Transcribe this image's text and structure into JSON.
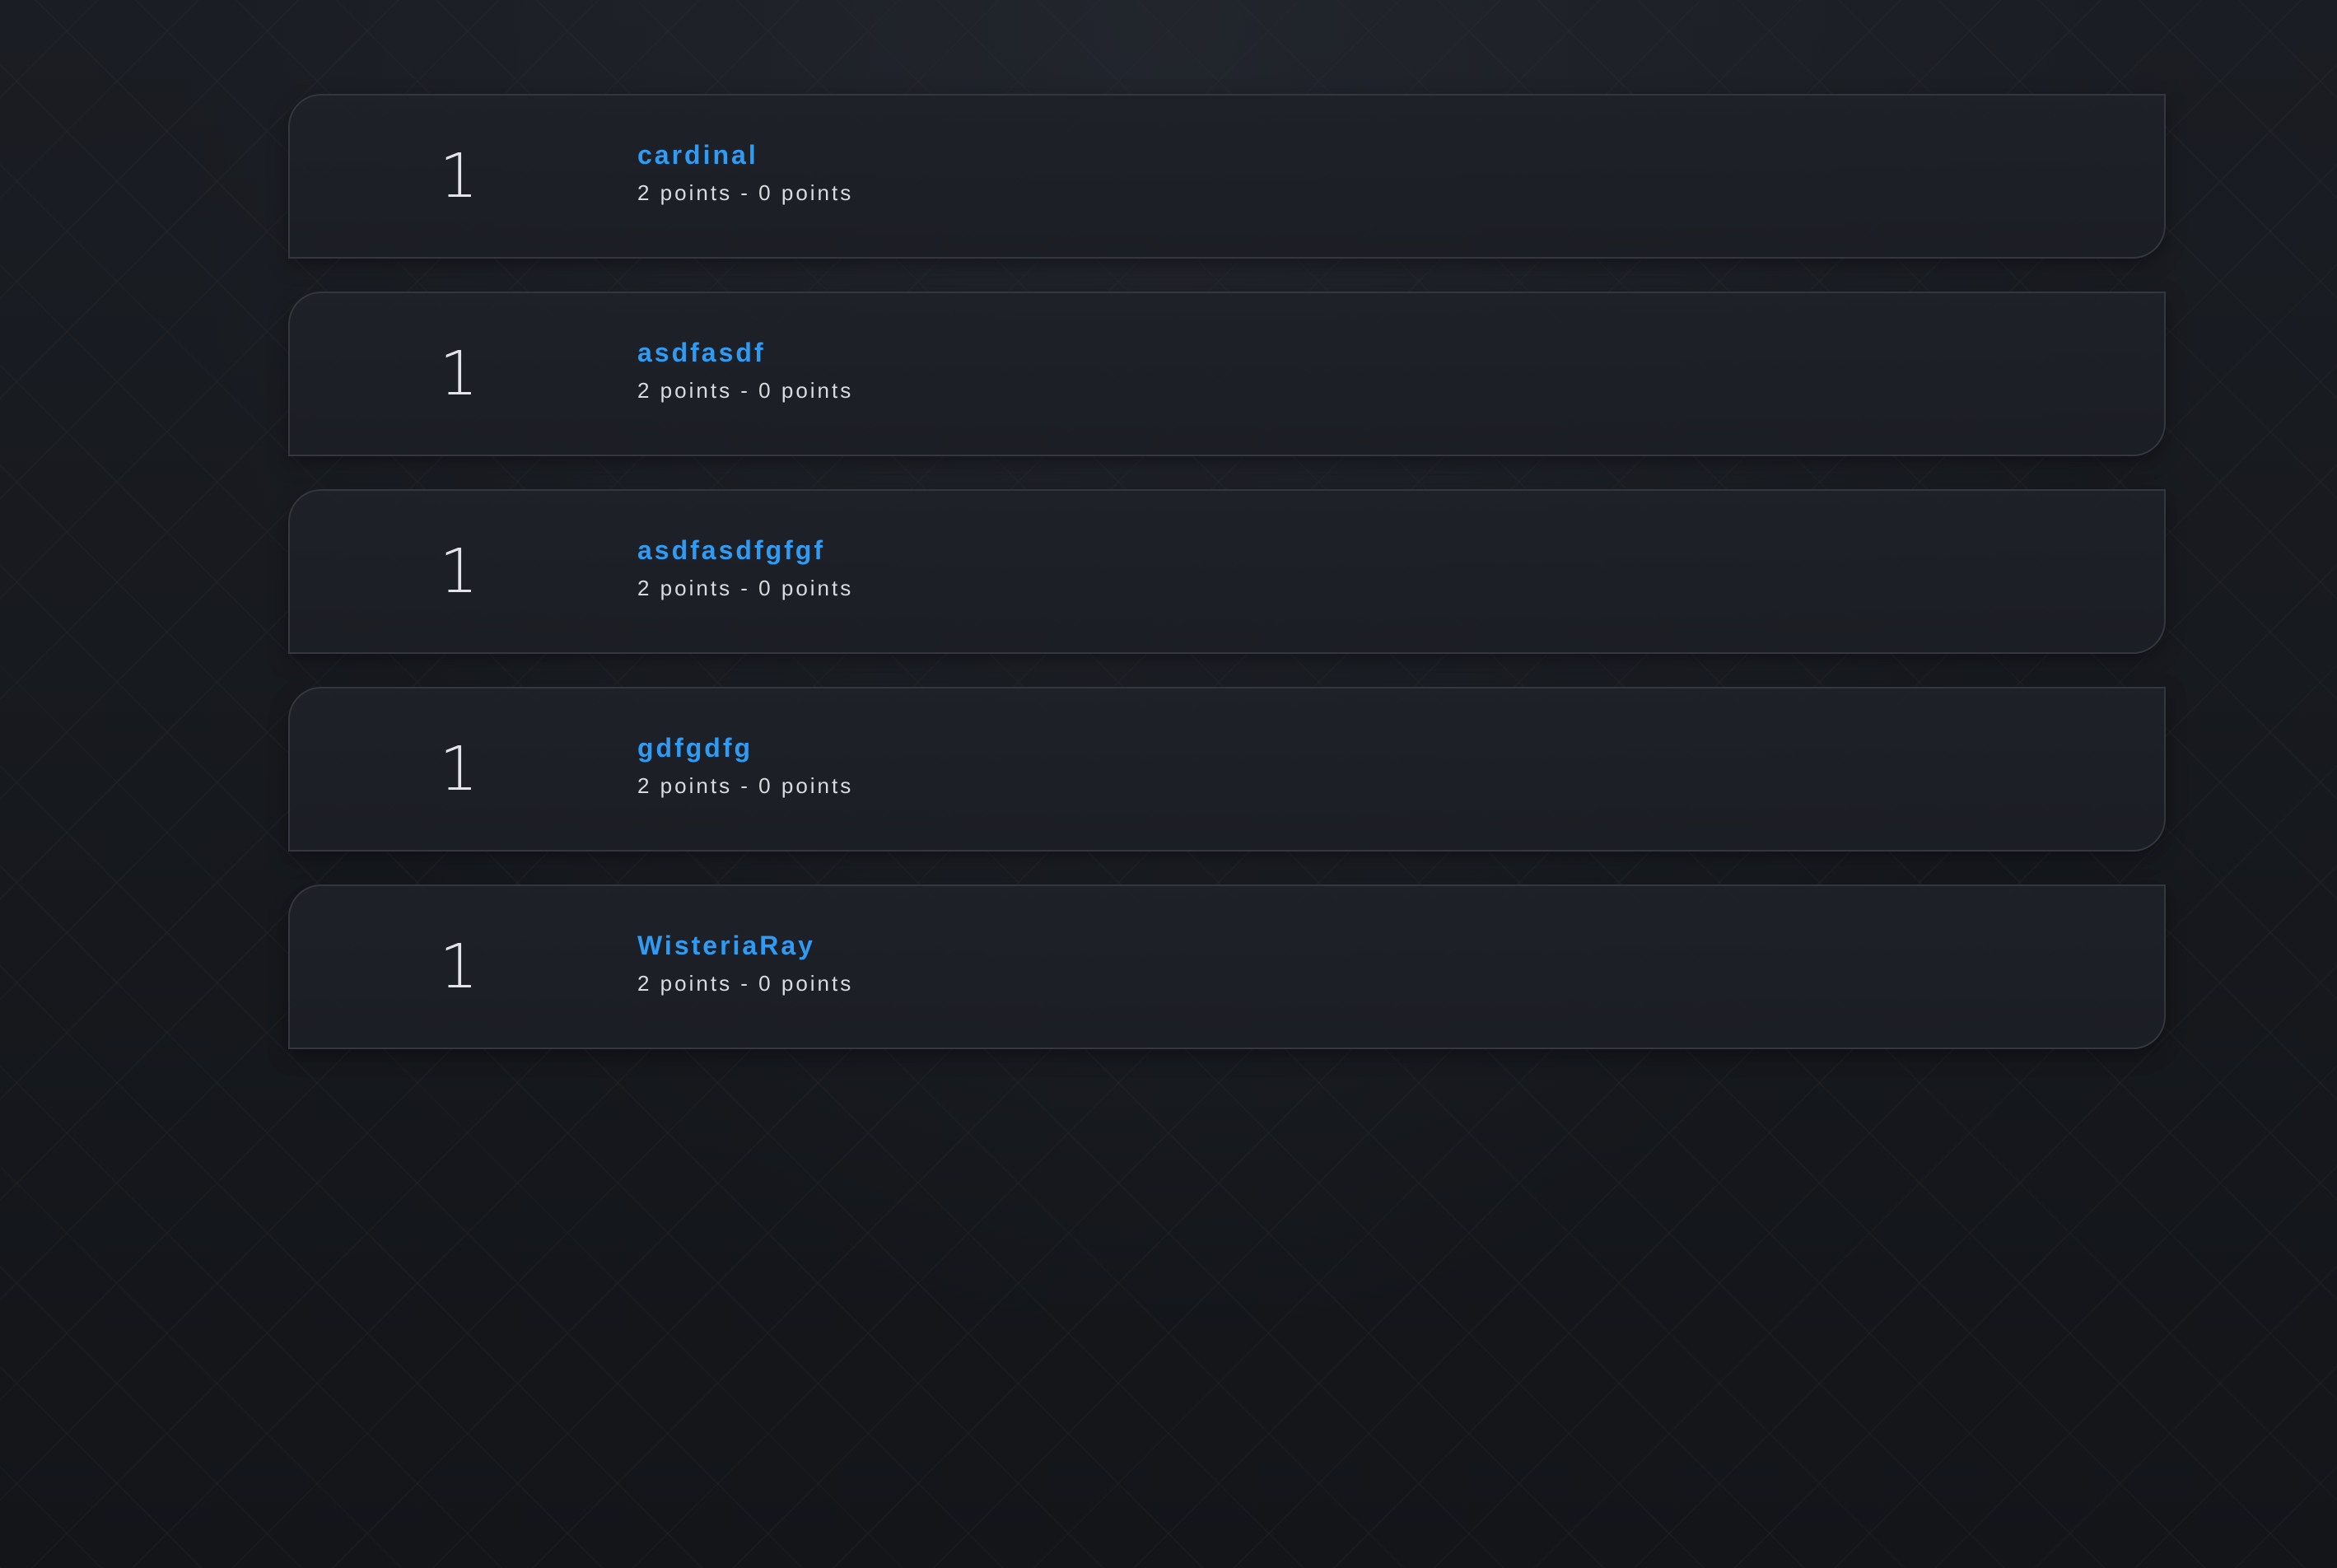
{
  "leaderboard": {
    "entries": [
      {
        "rank": "1",
        "name": "cardinal",
        "points": "2 points - 0 points"
      },
      {
        "rank": "1",
        "name": "asdfasdf",
        "points": "2 points - 0 points"
      },
      {
        "rank": "1",
        "name": "asdfasdfgfgf",
        "points": "2 points - 0 points"
      },
      {
        "rank": "1",
        "name": "gdfgdfg",
        "points": "2 points - 0 points"
      },
      {
        "rank": "1",
        "name": "WisteriaRay",
        "points": "2 points - 0 points"
      }
    ]
  },
  "colors": {
    "accent": "#2f9bf2",
    "background": "#14171d",
    "card": "#1c1f25",
    "card_border": "#34373e",
    "text": "#d8dbe0"
  }
}
